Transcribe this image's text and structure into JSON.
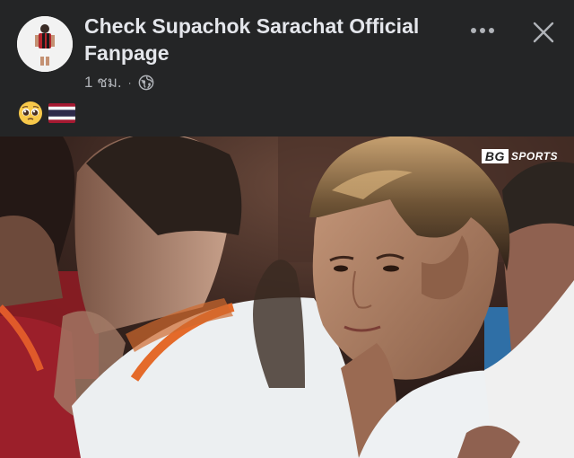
{
  "post": {
    "page_name": "Check Supachok Sarachat Official Fanpage",
    "timestamp": "1 ชม.",
    "separator": "·",
    "audience_icon": "globe-icon",
    "caption_emojis": [
      "pleading-face-emoji",
      "thailand-flag-emoji"
    ]
  },
  "actions": {
    "more_icon": "more-horizontal-icon",
    "close_icon": "close-icon"
  },
  "photo": {
    "watermark": {
      "logo": "BG",
      "text": "SPORTS"
    },
    "description_icon": "player-photo"
  },
  "colors": {
    "background": "#242526",
    "text_primary": "#e4e6eb",
    "text_secondary": "#b0b3b8",
    "team_red": "#b3242b",
    "flag_blue": "#2d2a4a",
    "flag_red": "#a51931"
  }
}
